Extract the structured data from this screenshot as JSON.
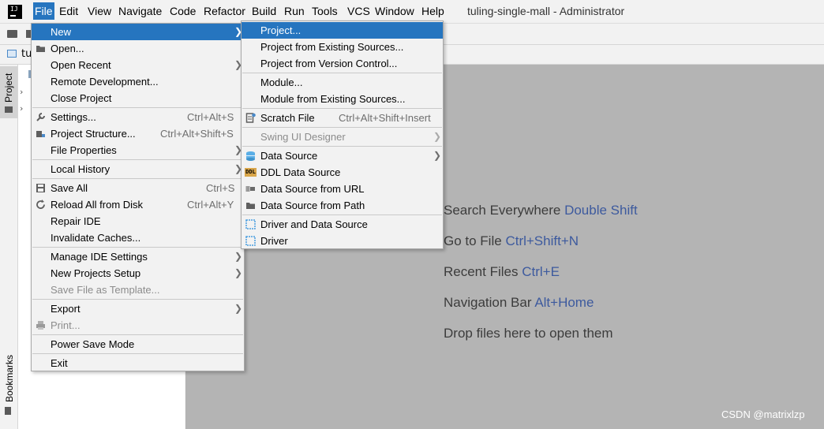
{
  "menubar": {
    "items": [
      "File",
      "Edit",
      "View",
      "Navigate",
      "Code",
      "Refactor",
      "Build",
      "Run",
      "Tools",
      "VCS",
      "Window",
      "Help"
    ],
    "window_title": "tuling-single-mall - Administrator"
  },
  "navbar": {
    "project_crumb": "tuling-single-mall"
  },
  "left_strip": {
    "project_tab": "Project",
    "bookmarks_tab": "Bookmarks"
  },
  "file_menu": {
    "new": "New",
    "open": "Open...",
    "open_recent": "Open Recent",
    "remote_development": "Remote Development...",
    "close_project": "Close Project",
    "settings": "Settings...",
    "settings_shortcut": "Ctrl+Alt+S",
    "project_structure": "Project Structure...",
    "project_structure_shortcut": "Ctrl+Alt+Shift+S",
    "file_properties": "File Properties",
    "local_history": "Local History",
    "save_all": "Save All",
    "save_all_shortcut": "Ctrl+S",
    "reload_all": "Reload All from Disk",
    "reload_all_shortcut": "Ctrl+Alt+Y",
    "repair_ide": "Repair IDE",
    "invalidate_caches": "Invalidate Caches...",
    "manage_ide_settings": "Manage IDE Settings",
    "new_projects_setup": "New Projects Setup",
    "save_file_as_template": "Save File as Template...",
    "export": "Export",
    "print": "Print...",
    "power_save_mode": "Power Save Mode",
    "exit": "Exit"
  },
  "new_menu": {
    "project": "Project...",
    "project_existing": "Project from Existing Sources...",
    "project_vcs": "Project from Version Control...",
    "module": "Module...",
    "module_existing": "Module from Existing Sources...",
    "scratch_file": "Scratch File",
    "scratch_file_shortcut": "Ctrl+Alt+Shift+Insert",
    "swing_ui_designer": "Swing UI Designer",
    "data_source": "Data Source",
    "ddl_data_source": "DDL Data Source",
    "ddl_icon_text": "DDL",
    "data_source_url": "Data Source from URL",
    "data_source_path": "Data Source from Path",
    "driver_and_data_source": "Driver and Data Source",
    "driver": "Driver"
  },
  "editor_hints": [
    {
      "text": "Search Everywhere",
      "key": "Double Shift"
    },
    {
      "text": "Go to File",
      "key": "Ctrl+Shift+N"
    },
    {
      "text": "Recent Files",
      "key": "Ctrl+E"
    },
    {
      "text": "Navigation Bar",
      "key": "Alt+Home"
    },
    {
      "text": "Drop files here to open them",
      "key": ""
    }
  ],
  "watermark": "CSDN @matrixlzp",
  "colors": {
    "accent": "#2675bf",
    "editor_bg": "#b4b4b4",
    "menu_bg": "#f2f2f2",
    "shortcut_key": "#3d5a9e"
  }
}
